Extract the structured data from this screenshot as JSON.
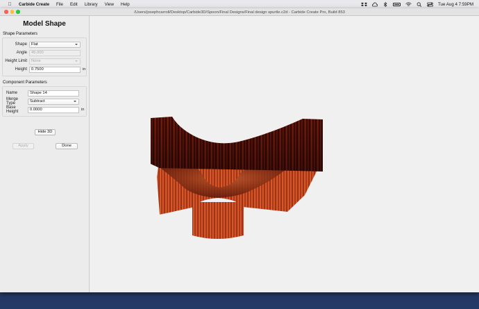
{
  "menubar": {
    "app_name": "Carbide Create",
    "menus": [
      "File",
      "Edit",
      "Library",
      "View",
      "Help"
    ],
    "clock": "Tue Aug 4  7:59PM"
  },
  "window": {
    "title": "/Users/josephcarroll/Desktop/Carbide3D/Spoon/Final Designs/Final design spurtle.c2d - Carbide Create Pro, Build 853"
  },
  "panel": {
    "title": "Model Shape",
    "shape_section": {
      "label": "Shape Parameters",
      "shape_label": "Shape",
      "shape_value": "Flat",
      "angle_label": "Angle",
      "angle_value": "45.000",
      "height_limit_label": "Height Limit",
      "height_limit_value": "None",
      "height_label": "Height",
      "height_value": "0.7500",
      "height_unit": "in"
    },
    "component_section": {
      "label": "Component Parameters",
      "name_label": "Name",
      "name_value": "Shape 14",
      "merge_label": "Merge Type",
      "merge_value": "Subtract",
      "base_height_label": "Base Height",
      "base_height_value": "0.0000",
      "base_height_unit": "in"
    },
    "hide3d_label": "Hide 3D",
    "apply_label": "Apply",
    "done_label": "Done"
  },
  "colors": {
    "wood_dark": "#3f0a06",
    "wood_mid": "#7a1d0f",
    "wood_light": "#c9471f",
    "viewport_bg": "#f0f0f0"
  }
}
